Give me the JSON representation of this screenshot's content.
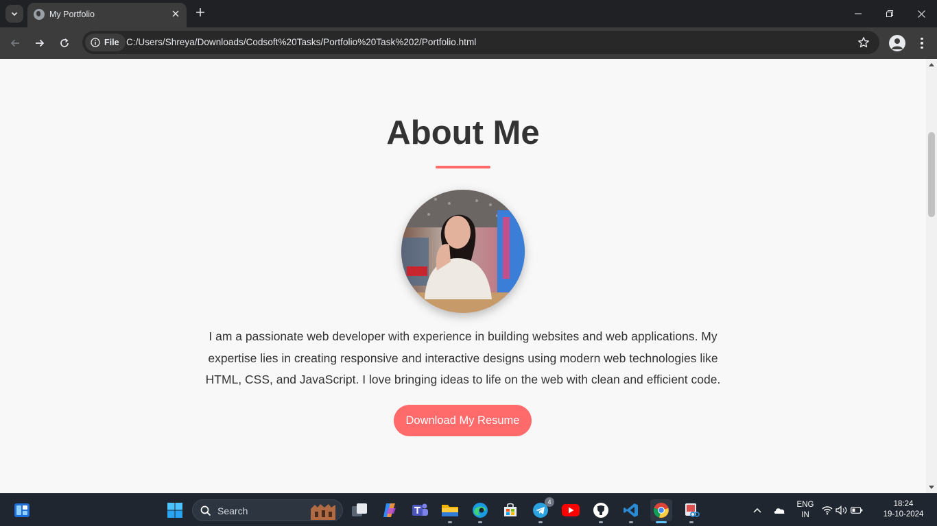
{
  "browser": {
    "tab_title": "My Portfolio",
    "security_chip": "File",
    "url": "C:/Users/Shreya/Downloads/Codsoft%20Tasks/Portfolio%20Task%202/Portfolio.html"
  },
  "page": {
    "heading": "About Me",
    "bio": "I am a passionate web developer with experience in building websites and web applications. My expertise lies in creating responsive and interactive designs using modern web technologies like HTML, CSS, and JavaScript. I love bringing ideas to life on the web with clean and efficient code.",
    "resume_button": "Download My Resume",
    "accent_color": "#ff6b6b"
  },
  "taskbar": {
    "search_label": "Search",
    "telegram_badge": "4",
    "language_line1": "ENG",
    "language_line2": "IN",
    "time": "18:24",
    "date": "19-10-2024",
    "apps": [
      "widgets-icon",
      "start-icon",
      "task-view-icon",
      "copilot-icon",
      "teams-icon",
      "file-explorer-icon",
      "edge-icon",
      "store-icon",
      "telegram-icon",
      "youtube-icon",
      "github-icon",
      "vscode-icon",
      "chrome-icon",
      "snipping-tool-icon"
    ]
  }
}
